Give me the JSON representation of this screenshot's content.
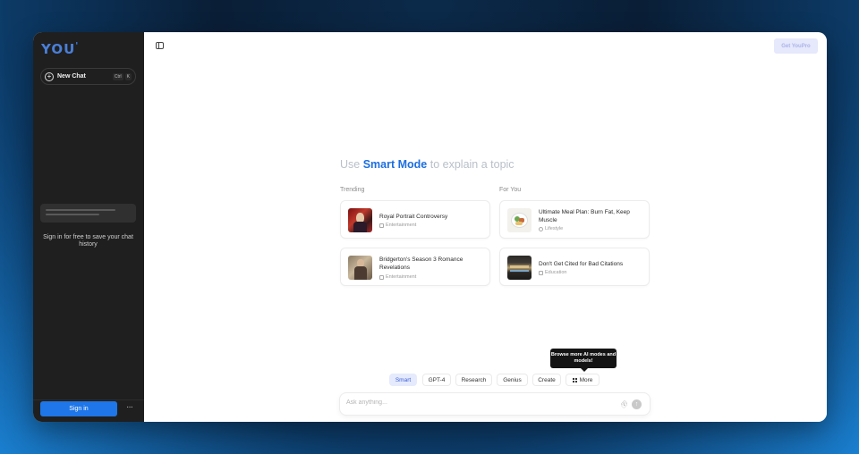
{
  "sidebar": {
    "logo": "YOU",
    "new_chat": {
      "label": "New Chat",
      "shortcut": [
        "Ctrl",
        "K"
      ]
    },
    "history_message": "Sign in for free to save your chat history",
    "sign_in_label": "Sign in",
    "more_label": "···"
  },
  "header": {
    "get_pro_label": "Get YouPro"
  },
  "main": {
    "headline": {
      "prefix": "Use",
      "highlight": "Smart Mode",
      "suffix": "to explain a topic"
    },
    "sections": [
      {
        "label": "Trending",
        "cards": [
          {
            "title": "Royal Portrait Controversy",
            "category": "Entertainment",
            "icon": "image-icon"
          },
          {
            "title": "Bridgerton's Season 3 Romance Revelations",
            "category": "Entertainment",
            "icon": "image-icon"
          }
        ]
      },
      {
        "label": "For You",
        "cards": [
          {
            "title": "Ultimate Meal Plan: Burn Fat, Keep Muscle",
            "category": "Lifestyle",
            "icon": "lifestyle-icon"
          },
          {
            "title": "Don't Get Cited for Bad Citations",
            "category": "Education",
            "icon": "education-icon"
          }
        ]
      }
    ],
    "tooltip": "Browse more AI modes and models!",
    "modes": [
      "Smart",
      "GPT-4",
      "Research",
      "Genius",
      "Create",
      "More"
    ],
    "active_mode": "Smart",
    "ask_placeholder": "Ask anything..."
  },
  "colors": {
    "accent": "#1d6fe0",
    "sidebar_bg": "#1f1f1f",
    "sign_in_bg": "#1e76e8"
  }
}
